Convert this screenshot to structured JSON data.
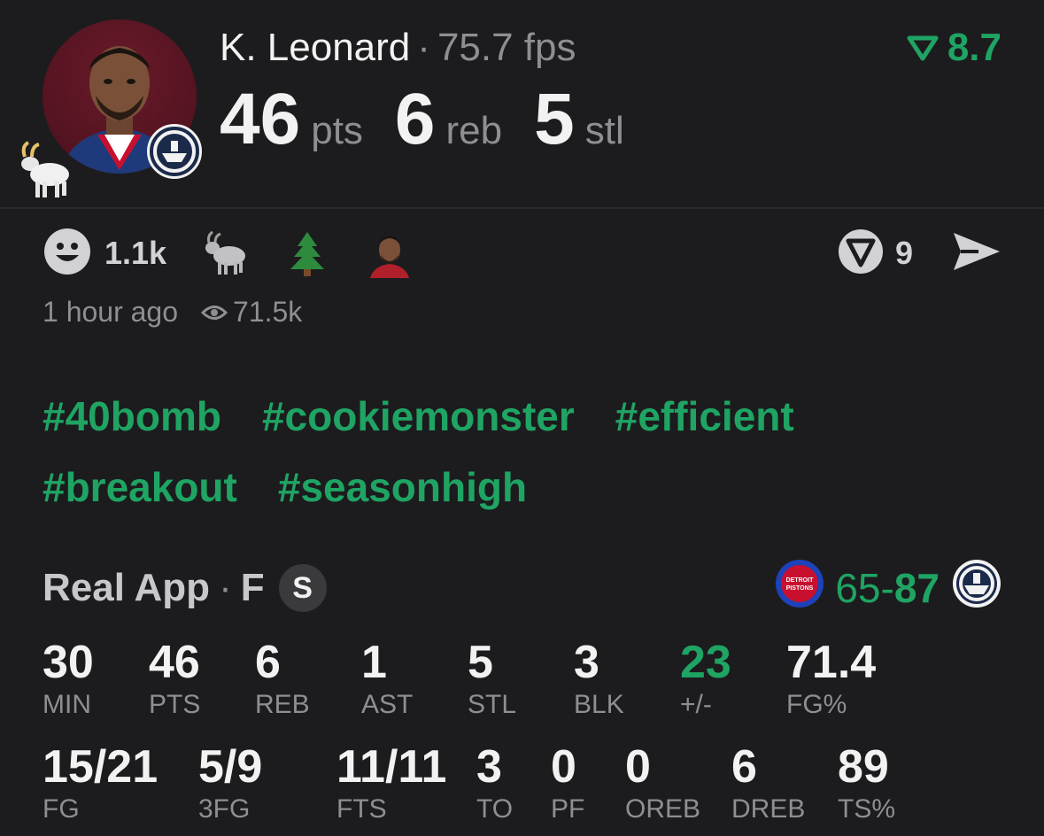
{
  "player": {
    "name": "K. Leonard",
    "fps": "75.7 fps",
    "rating": "8.7",
    "stats": [
      {
        "value": "46",
        "unit": "pts"
      },
      {
        "value": "6",
        "unit": "reb"
      },
      {
        "value": "5",
        "unit": "stl"
      }
    ]
  },
  "reactions": {
    "count": "1.1k",
    "emojis": [
      "goat-emoji",
      "tree-emoji",
      "player-face-emoji"
    ],
    "v_count": "9"
  },
  "meta": {
    "time": "1 hour ago",
    "views": "71.5k"
  },
  "hashtags": [
    "#40bomb",
    "#cookiemonster",
    "#efficient",
    "#breakout",
    "#seasonhigh"
  ],
  "game": {
    "source": "Real App",
    "status": "F",
    "badge": "S",
    "opponent_score": "65",
    "team_score": "87",
    "opponent_logo_text": "DETROIT PISTONS"
  },
  "box_row1": [
    {
      "value": "30",
      "label": "MIN"
    },
    {
      "value": "46",
      "label": "PTS"
    },
    {
      "value": "6",
      "label": "REB"
    },
    {
      "value": "1",
      "label": "AST"
    },
    {
      "value": "5",
      "label": "STL"
    },
    {
      "value": "3",
      "label": "BLK"
    },
    {
      "value": "23",
      "label": "+/-"
    },
    {
      "value": "71.4",
      "label": "FG%"
    }
  ],
  "box_row2": [
    {
      "value": "15/21",
      "label": "FG"
    },
    {
      "value": "5/9",
      "label": "3FG"
    },
    {
      "value": "11/11",
      "label": "FTS"
    },
    {
      "value": "3",
      "label": "TO"
    },
    {
      "value": "0",
      "label": "PF"
    },
    {
      "value": "0",
      "label": "OREB"
    },
    {
      "value": "6",
      "label": "DREB"
    },
    {
      "value": "89",
      "label": "TS%"
    }
  ],
  "colors": {
    "background": "#1c1c1e",
    "accent_green": "#1fa463",
    "muted": "#8e8e93"
  }
}
